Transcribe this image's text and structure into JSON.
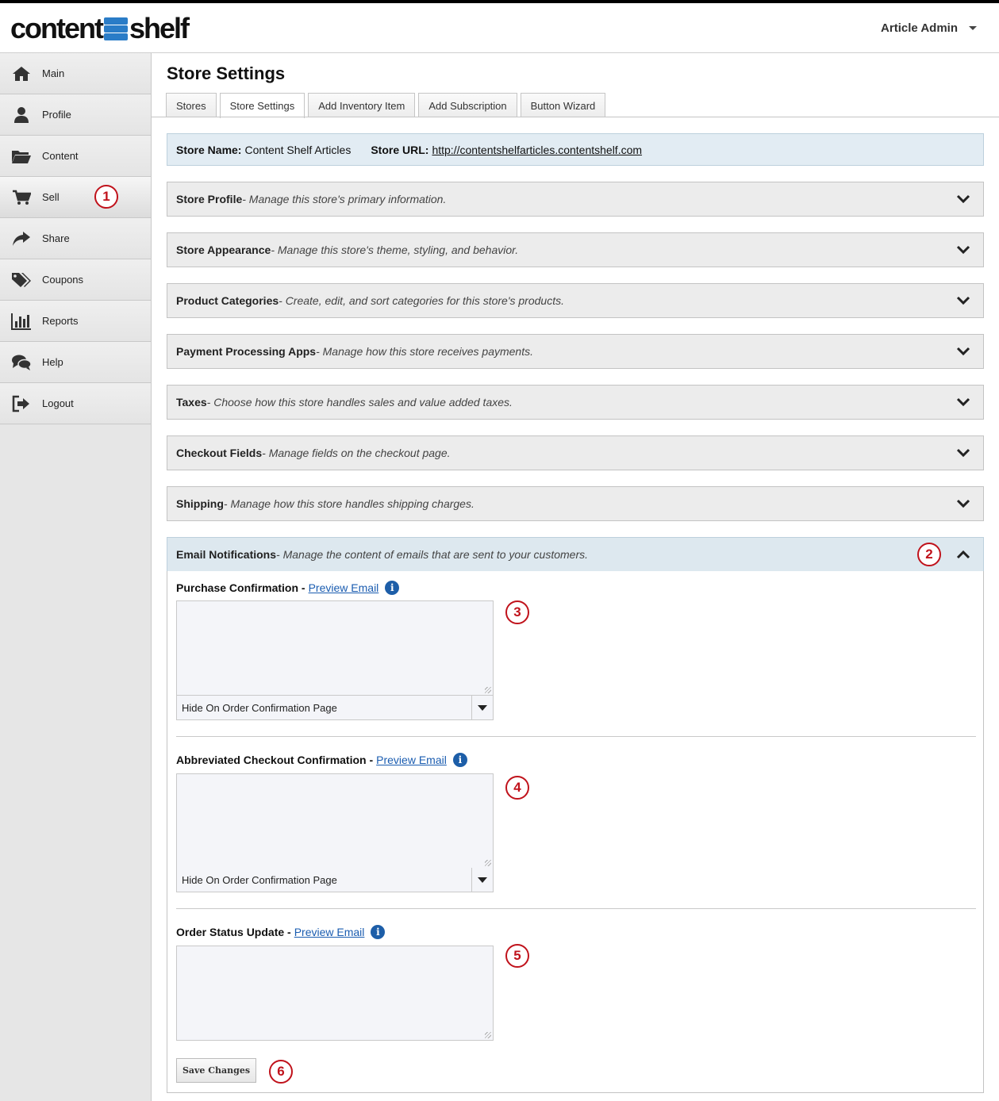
{
  "header": {
    "logo_left": "content",
    "logo_right": "shelf",
    "user_label": "Article Admin"
  },
  "sidebar": {
    "items": [
      {
        "label": "Main",
        "icon": "home-icon"
      },
      {
        "label": "Profile",
        "icon": "user-icon"
      },
      {
        "label": "Content",
        "icon": "folder-icon"
      },
      {
        "label": "Sell",
        "icon": "cart-icon"
      },
      {
        "label": "Share",
        "icon": "share-arrow-icon"
      },
      {
        "label": "Coupons",
        "icon": "tags-icon"
      },
      {
        "label": "Reports",
        "icon": "bar-chart-icon"
      },
      {
        "label": "Help",
        "icon": "chat-bubbles-icon"
      },
      {
        "label": "Logout",
        "icon": "logout-icon"
      }
    ],
    "active": "Sell"
  },
  "main": {
    "title": "Store Settings",
    "tabs": [
      {
        "label": "Stores"
      },
      {
        "label": "Store Settings"
      },
      {
        "label": "Add Inventory Item"
      },
      {
        "label": "Add Subscription"
      },
      {
        "label": "Button Wizard"
      }
    ],
    "active_tab": "Store Settings",
    "store_bar": {
      "name_label": "Store Name:",
      "name_value": "Content Shelf Articles",
      "url_label": "Store URL:",
      "url_value": "http://contentshelfarticles.contentshelf.com"
    },
    "sections": [
      {
        "title": "Store Profile",
        "desc": " - Manage this store's primary information."
      },
      {
        "title": "Store Appearance",
        "desc": " - Manage this store's theme, styling, and behavior."
      },
      {
        "title": "Product Categories",
        "desc": " - Create, edit, and sort categories for this store's products."
      },
      {
        "title": "Payment Processing Apps",
        "desc": " - Manage how this store receives payments."
      },
      {
        "title": "Taxes",
        "desc": " - Choose how this store handles sales and value added taxes."
      },
      {
        "title": "Checkout Fields",
        "desc": " - Manage fields on the checkout page."
      },
      {
        "title": "Shipping",
        "desc": " - Manage how this store handles shipping charges."
      },
      {
        "title": "Email Notifications",
        "desc": " - Manage the content of emails that are sent to your customers."
      }
    ],
    "emails": [
      {
        "title": "Purchase Confirmation - ",
        "link": "Preview Email",
        "select_value": "Hide On Order Confirmation Page"
      },
      {
        "title": "Abbreviated Checkout Confirmation - ",
        "link": "Preview Email",
        "select_value": "Hide On Order Confirmation Page"
      },
      {
        "title": "Order Status Update - ",
        "link": "Preview Email"
      }
    ],
    "save_label": "Save Changes"
  },
  "callouts": [
    "1",
    "2",
    "3",
    "4",
    "5",
    "6"
  ],
  "colors": {
    "accent_blue": "#2a7cc7",
    "link_blue": "#1a5cb0",
    "callout_red": "#c0121b",
    "open_section_bg": "#dde8ef"
  }
}
